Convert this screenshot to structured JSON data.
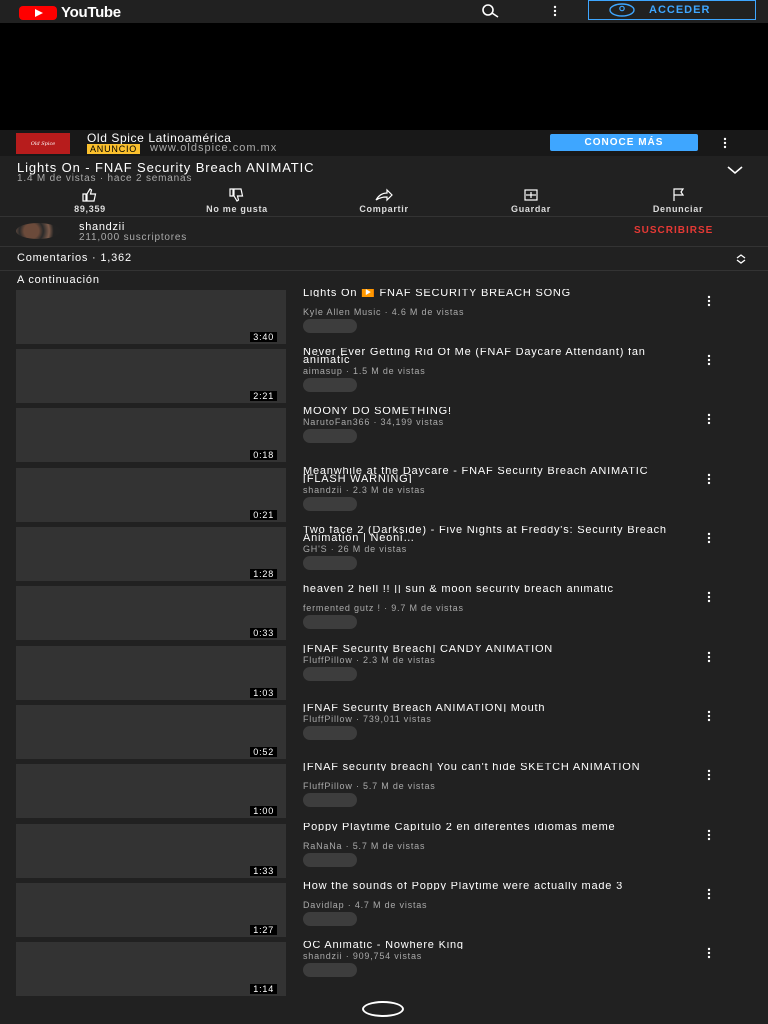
{
  "header": {
    "logo_text": "YouTube",
    "login_label": "ACCEDER"
  },
  "ad": {
    "thumb_text": "Old Spice",
    "title": "Old Spice Latinoamérica",
    "badge": "ANUNCIO",
    "url": "www.oldspice.com.mx",
    "cta": "CONOCE MÁS",
    "brand_color": "#b71c1c"
  },
  "video": {
    "title": "Lights On - FNAF Security Breach ANIMATIC",
    "meta": "1.4 M de vistas · hace 2 semanas"
  },
  "actions": {
    "like": "89,359",
    "dislike": "No me gusta",
    "share": "Compartir",
    "save": "Guardar",
    "report": "Denunciar"
  },
  "channel": {
    "name": "shandzii",
    "subs": "211,000 suscriptores",
    "subscribe": "SUSCRIBIRSE"
  },
  "comments": {
    "label": "Comentarios · 1,362"
  },
  "upnext": {
    "label": "A continuación",
    "items": [
      {
        "title": "Lights On ▶️ FNAF SECURITY BREACH SONG",
        "meta": "Kyle Allen Music · 4.6 M de vistas",
        "duration": "3:40",
        "two_line": true
      },
      {
        "title": "Never Ever Getting Rid Of Me (FNAF Daycare Attendant) fan animatic",
        "meta": "aimasup · 1.5 M de vistas",
        "duration": "2:21",
        "two_line": true
      },
      {
        "title": "MOONY DO SOMETHING!",
        "meta": "NarutoFan366 · 34,199 vistas",
        "duration": "0:18",
        "two_line": false
      },
      {
        "title": "Meanwhile at the Daycare - FNAF Security Breach ANIMATIC [FLASH WARNING]",
        "meta": "shandzii · 2.3 M de vistas",
        "duration": "0:21",
        "two_line": true
      },
      {
        "title": "Two face 2 (Darkside) - Five Nights at Freddy's: Security Breach Animation | Neoni…",
        "meta": "GH'S · 26 M de vistas",
        "duration": "1:28",
        "two_line": true
      },
      {
        "title": "heaven 2 hell !! || sun & moon security breach animatic",
        "meta": "fermented gutz ! · 9.7 M de vistas",
        "duration": "0:33",
        "two_line": true
      },
      {
        "title": "[FNAF Security Breach] CANDY ANIMATION",
        "meta": "FluffPillow · 2.3 M de vistas",
        "duration": "1:03",
        "two_line": false
      },
      {
        "title": "[FNAF Security Breach ANIMATION] Mouth",
        "meta": "FluffPillow · 739,011 vistas",
        "duration": "0:52",
        "two_line": false
      },
      {
        "title": "[FNAF security breach] You can't hide SKETCH ANIMATION",
        "meta": "FluffPillow · 5.7 M de vistas",
        "duration": "1:00",
        "two_line": true
      },
      {
        "title": "Poppy Playtime Capítulo 2 en diferentes idiomas meme",
        "meta": "RaNaNa · 5.7 M de vistas",
        "duration": "1:33",
        "two_line": true
      },
      {
        "title": "How the sounds of Poppy Playtime were actually made 3",
        "meta": "Davidlap · 4.7 M de vistas",
        "duration": "1:27",
        "two_line": true
      },
      {
        "title": "OC Animatic - Nowhere King",
        "meta": "shandzii · 909,754 vistas",
        "duration": "1:14",
        "two_line": false
      }
    ]
  }
}
